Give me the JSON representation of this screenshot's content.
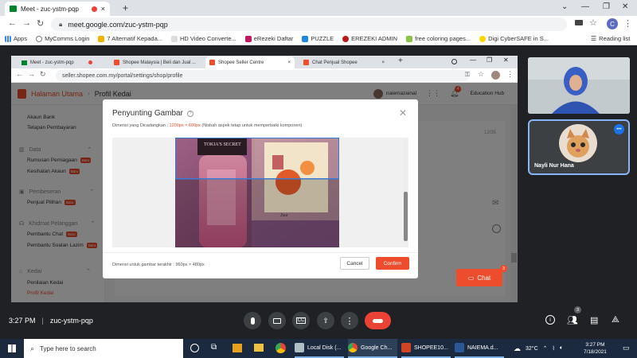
{
  "browser": {
    "tab_title": "Meet - zuc-ystm-pqp",
    "url": "meet.google.com/zuc-ystm-pqp",
    "profile_initial": "C",
    "reading_list": "Reading list",
    "bookmarks": [
      "Apps",
      "MyComms Login",
      "7 Alternatif Kepada...",
      "HD Video Converte...",
      "eRezeki Daftar",
      "PUZZLE",
      "EREZEKI ADMIN",
      "free coloring pages...",
      "Digi CyberSAFE in S..."
    ]
  },
  "shared": {
    "tabs": [
      "Meet - zuc-ystm-pqp",
      "Shopee Malaysia | Beli dan Jual ...",
      "Shopee Seller Centre",
      "Chat Penjual Shopee"
    ],
    "url": "seller.shopee.com.my/portal/settings/shop/profile",
    "breadcrumb_home": "Halaman Utama",
    "breadcrumb_current": "Profil Kedai",
    "username": "naiemazainal",
    "edu_hub": "Education Hub",
    "notif_count": "4",
    "sidebar": {
      "top_items": [
        "Akaun Bank",
        "Tetapan Pembayaran"
      ],
      "data_group": "Data",
      "data_items": [
        "Rumusan Perniagaan",
        "Kesihatan Akaun"
      ],
      "pembeli_group": "Pembeseran",
      "pembeli_items": [
        "Penjual Pilihan"
      ],
      "khidmat_group": "Khidmat Pelanggan",
      "khidmat_items": [
        "Pembantu Chat",
        "Pembantu Soalan Lazim"
      ],
      "kedai_group": "Kedai",
      "kedai_items": [
        "Penilaian Kedai",
        "Profil Kedai"
      ],
      "new_badge": "Baru"
    },
    "char_count": "12/35",
    "modal": {
      "title": "Penyunting Gambar",
      "subtitle_prefix": "Dimensi yang Dicadangkan : ",
      "subtitle_dims": "1200px × 600px",
      "subtitle_suffix": " (Nisbah aspek tetap untuk memperbaiki komponen)",
      "footer": "Dimensi untuk gambar terakhir : 960px × 480px",
      "cancel": "Cancel",
      "confirm": "Confirm",
      "photo_box_text": "TOKIA'S SECRET",
      "photo_label": "Juur"
    },
    "chat_label": "Chat",
    "chat_count": "3"
  },
  "participants": {
    "nayli": "Nayli Nur Hana"
  },
  "meet_bar": {
    "time": "3:27 PM",
    "meeting_code": "zuc-ystm-pqp",
    "people_count": "3"
  },
  "taskbar": {
    "search_placeholder": "Type here to search",
    "apps": [
      "Local Disk (...",
      "Google Ch...",
      "SHOPEE10...",
      "NAIEMA.d..."
    ],
    "temperature": "32°C",
    "time": "3:27 PM",
    "date": "7/18/2021"
  },
  "colors": {
    "shopee_orange": "#ee4d2d",
    "meet_dark": "#202124",
    "end_call_red": "#ea4335"
  }
}
